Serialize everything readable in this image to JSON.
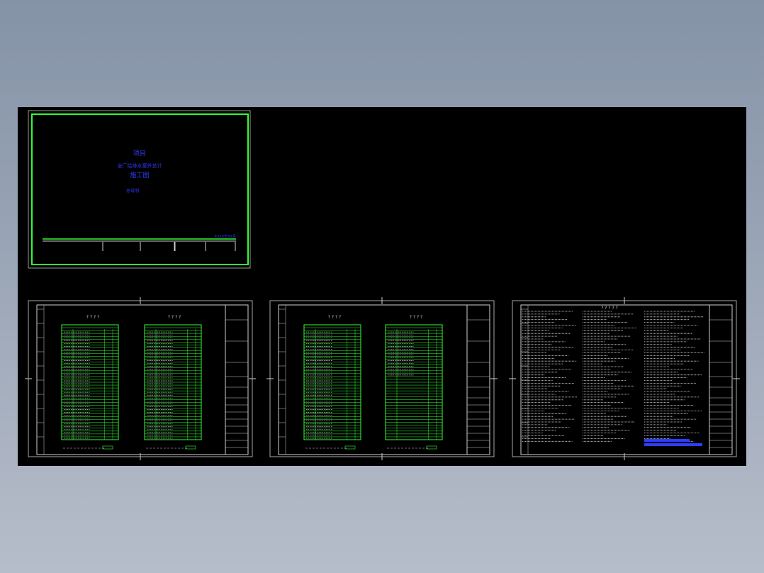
{
  "cover": {
    "line1": "项目",
    "line2": "全厂给排水室外总计",
    "line3": "施工图",
    "line4": "总说明",
    "corner_label": "XXXX年XX月"
  },
  "sheets": [
    {
      "left_table_title": "? ? ? ?",
      "right_table_title": "? ? ? ?"
    },
    {
      "left_table_title": "? ? ? ?",
      "right_table_title": "? ? ? ?"
    },
    {
      "title": "? ? ? ? ?"
    }
  ],
  "colors": {
    "background": "#000000",
    "border_green": "#33ff33",
    "text_blue": "#2f3dff",
    "line_white": "#cfcfcf"
  }
}
